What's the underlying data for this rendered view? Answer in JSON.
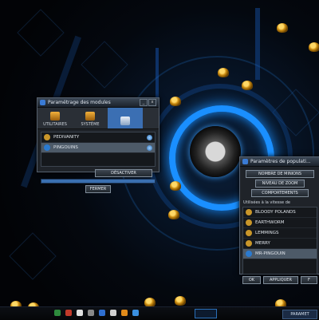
{
  "window_modules": {
    "title": "Paramétrage des modules",
    "tabs": [
      "UTILITAIRES",
      "SYSTÈME",
      ""
    ],
    "rows": [
      "PEDIVANITY",
      "PINGOUINS"
    ],
    "deactivate_label": "DÉSACTIVER",
    "close_label": "FERMER"
  },
  "window_population": {
    "title": "Paramètres de populati...",
    "min_label": "NOMBRE DE MINIONS",
    "level_label": "NIVEAU DE ZOOM",
    "reset_label": "COMPORTEMENTS",
    "list_header": "Utilisées à la vitesse de",
    "rows": [
      "BLOODY POLANDS",
      "EARTHWORM",
      "LEMMINGS",
      "MERRY",
      "MR-PINGOUIN"
    ],
    "ok_label": "OK",
    "apply_label": "APPLIQUER",
    "cancel_label": "F"
  },
  "taskbar": {
    "clock": "PARAMET"
  },
  "icons": {
    "sprite": "robot-creature-icon",
    "accent": "#1a8fff",
    "window_bg": "#1f2329",
    "selected": "#3b6fb3"
  }
}
